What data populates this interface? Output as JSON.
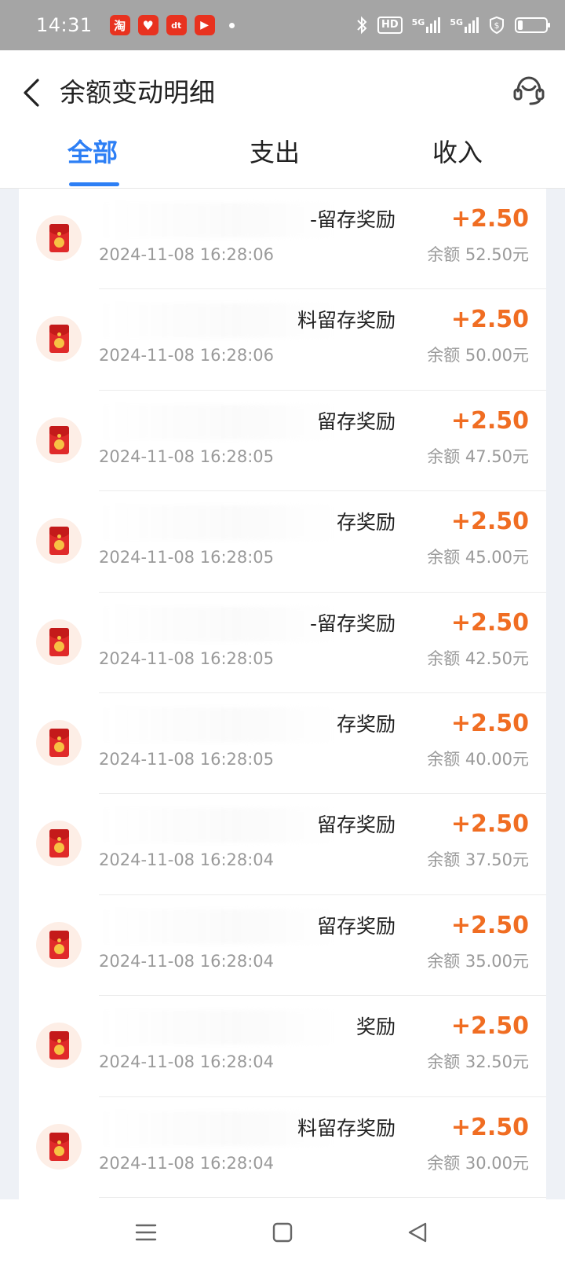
{
  "status_bar": {
    "time": "14:31",
    "app_icons": [
      "淘",
      "♥",
      "dt",
      "▶"
    ],
    "hd_label": "HD",
    "network_1": "5G",
    "network_2": "5G"
  },
  "header": {
    "title": "余额变动明细",
    "back_icon": "chevron-left-icon",
    "service_icon": "customer-service-icon"
  },
  "tabs": [
    {
      "label": "全部",
      "active": true
    },
    {
      "label": "支出",
      "active": false
    },
    {
      "label": "收入",
      "active": false
    }
  ],
  "records": [
    {
      "title": "-留存奖励",
      "time": "2024-11-08 16:28:06",
      "amount": "+2.50",
      "balance": "余额 52.50元"
    },
    {
      "title": "料留存奖励",
      "time": "2024-11-08 16:28:06",
      "amount": "+2.50",
      "balance": "余额 50.00元"
    },
    {
      "title": "留存奖励",
      "time": "2024-11-08 16:28:05",
      "amount": "+2.50",
      "balance": "余额 47.50元"
    },
    {
      "title": "存奖励",
      "time": "2024-11-08 16:28:05",
      "amount": "+2.50",
      "balance": "余额 45.00元"
    },
    {
      "title": "-留存奖励",
      "time": "2024-11-08 16:28:05",
      "amount": "+2.50",
      "balance": "余额 42.50元"
    },
    {
      "title": "存奖励",
      "time": "2024-11-08 16:28:05",
      "amount": "+2.50",
      "balance": "余额 40.00元"
    },
    {
      "title": "留存奖励",
      "time": "2024-11-08 16:28:04",
      "amount": "+2.50",
      "balance": "余额 37.50元"
    },
    {
      "title": "留存奖励",
      "time": "2024-11-08 16:28:04",
      "amount": "+2.50",
      "balance": "余额 35.00元"
    },
    {
      "title": "奖励",
      "time": "2024-11-08 16:28:04",
      "amount": "+2.50",
      "balance": "余额 32.50元"
    },
    {
      "title": "料留存奖励",
      "time": "2024-11-08 16:28:04",
      "amount": "+2.50",
      "balance": "余额 30.00元"
    }
  ],
  "colors": {
    "accent": "#2d7ff5",
    "amount": "#f06d22",
    "envelope": "#e02a2a"
  }
}
